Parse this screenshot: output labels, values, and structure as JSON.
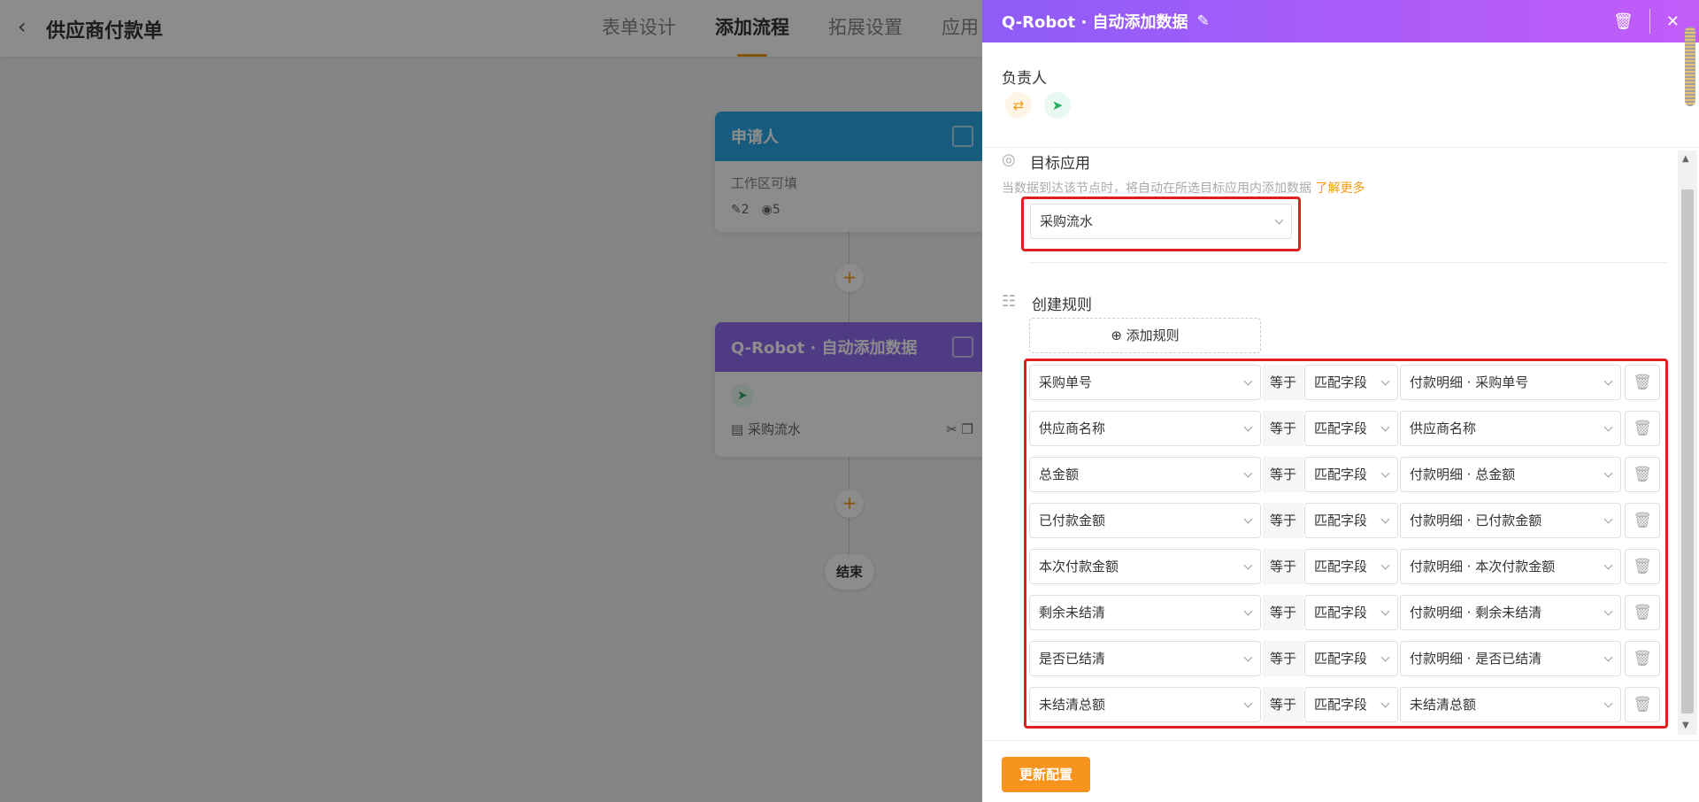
{
  "topbar": {
    "back_icon": "chevron-left-icon",
    "title": "供应商付款单",
    "tabs": [
      {
        "label": "表单设计",
        "active": false
      },
      {
        "label": "添加流程",
        "active": true
      },
      {
        "label": "拓展设置",
        "active": false
      },
      {
        "label": "应用",
        "active": false
      }
    ]
  },
  "canvas": {
    "node1": {
      "title": "申请人",
      "subtitle": "工作区可填",
      "edit_count": "2",
      "view_count": "5"
    },
    "node2": {
      "title": "Q-Robot · 自动添加数据",
      "target": "采购流水"
    },
    "end_label": "结束",
    "plus": "+"
  },
  "drawer": {
    "title": "Q-Robot · 自动添加数据",
    "owner_label": "负责人",
    "target_app_label": "目标应用",
    "target_app_desc": "当数据到达该节点时，将自动在所选目标应用内添加数据",
    "learn_more": "了解更多",
    "target_app_value": "采购流水",
    "create_rules_label": "创建规则",
    "add_rule_label": "添加规则",
    "equals_label": "等于",
    "match_label": "匹配字段",
    "rules": [
      {
        "field": "采购单号",
        "target": "付款明细 · 采购单号"
      },
      {
        "field": "供应商名称",
        "target": "供应商名称"
      },
      {
        "field": "总金额",
        "target": "付款明细 · 总金额"
      },
      {
        "field": "已付款金额",
        "target": "付款明细 · 已付款金额"
      },
      {
        "field": "本次付款金额",
        "target": "付款明细 · 本次付款金额"
      },
      {
        "field": "剩余未结清",
        "target": "付款明细 · 剩余未结清"
      },
      {
        "field": "是否已结清",
        "target": "付款明细 · 是否已结清"
      },
      {
        "field": "未结清总额",
        "target": "未结清总额"
      }
    ],
    "update_button": "更新配置"
  },
  "colors": {
    "accent": "#f7941d",
    "drawer_gradient_start": "#8e5cf7",
    "drawer_gradient_end": "#c25cf9",
    "highlight_box": "#e02020",
    "node_blue": "#2aa8e6",
    "node_purple": "#8e6cf0"
  }
}
